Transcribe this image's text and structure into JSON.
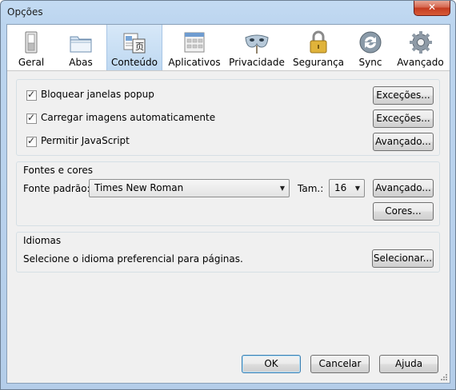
{
  "window": {
    "title": "Opções",
    "close_label": "✕"
  },
  "tabs": [
    {
      "label": "Geral",
      "icon": "switch-icon"
    },
    {
      "label": "Abas",
      "icon": "folder-tabs-icon"
    },
    {
      "label": "Conteúdo",
      "icon": "content-document-icon",
      "selected": true
    },
    {
      "label": "Aplicativos",
      "icon": "applications-icon"
    },
    {
      "label": "Privacidade",
      "icon": "mask-icon"
    },
    {
      "label": "Segurança",
      "icon": "padlock-icon"
    },
    {
      "label": "Sync",
      "icon": "sync-icon"
    },
    {
      "label": "Avançado",
      "icon": "gear-icon"
    }
  ],
  "content": {
    "popup": {
      "label": "Bloquear janelas popup",
      "checked": true,
      "button": "Exceções..."
    },
    "images": {
      "label": "Carregar imagens automaticamente",
      "checked": true,
      "button": "Exceções..."
    },
    "javascript": {
      "label": "Permitir JavaScript",
      "checked": true,
      "button": "Avançado..."
    }
  },
  "fonts": {
    "title": "Fontes e cores",
    "default_font_label": "Fonte padrão:",
    "default_font_value": "Times New Roman",
    "size_label": "Tam.:",
    "size_value": "16",
    "advanced_button": "Avançado...",
    "colors_button": "Cores..."
  },
  "languages": {
    "title": "Idiomas",
    "description": "Selecione o idioma preferencial para páginas.",
    "choose_button": "Selecionar..."
  },
  "footer": {
    "ok": "OK",
    "cancel": "Cancelar",
    "help": "Ajuda"
  }
}
